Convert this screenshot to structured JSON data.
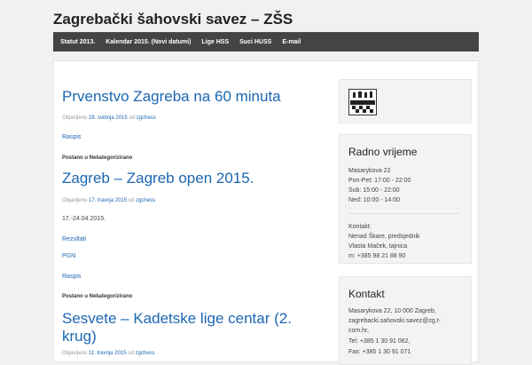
{
  "site": {
    "title": "Zagrebački šahovski savez – ZŠS"
  },
  "nav": {
    "items": [
      {
        "label": "Statut 2013."
      },
      {
        "label": "Kalendar 2015. (Novi datumi)"
      },
      {
        "label": "Lige HSS"
      },
      {
        "label": "Suci HUSS"
      },
      {
        "label": "E-mail"
      }
    ]
  },
  "posts": [
    {
      "title": "Prvenstvo Zagreba na 60 minuta",
      "meta_prefix": "Objavljeno",
      "date": "28. svibnja 2015",
      "meta_by": "od",
      "author": "zgchess",
      "links": [
        "Raspis"
      ],
      "category_line": "Postano u Nekategorizirano"
    },
    {
      "title": "Zagreb – Zagreb open 2015.",
      "meta_prefix": "Objavljeno",
      "date": "17. travnja 2015",
      "meta_by": "od",
      "author": "zgchess",
      "text": "17.-24.04.2015.",
      "links": [
        "Rezultati",
        "PGN",
        "Raspis"
      ],
      "category_line": "Postano u Nekategorizirano"
    },
    {
      "title": "Sesvete – Kadetske lige centar (2. krug)",
      "meta_prefix": "Objavljeno",
      "date": "11. travnja 2015",
      "meta_by": "od",
      "author": "zgchess"
    }
  ],
  "sidebar": {
    "radno": {
      "title": "Radno vrijeme",
      "lines": [
        "Masarykova 22",
        "Pon-Pet: 17:00 - 22:00",
        "Sub: 15:00 - 22:00",
        "Ned: 10:00 - 14:00"
      ],
      "contact_lines": [
        "Kontakt:",
        "Nenad Škare, predsjednik",
        "Vlasta Maček, tajnica",
        "m: +385 98 21 88 90"
      ]
    },
    "kontakt": {
      "title": "Kontakt",
      "lines": [
        "Masarykova 22, 10 000 Zagreb,",
        "zagrebacki.sahovski.savez@zg.t-",
        "com.hr,",
        "Tel: +385 1 30 91 062,",
        "Fax: +385 1 30 91 071"
      ]
    }
  }
}
